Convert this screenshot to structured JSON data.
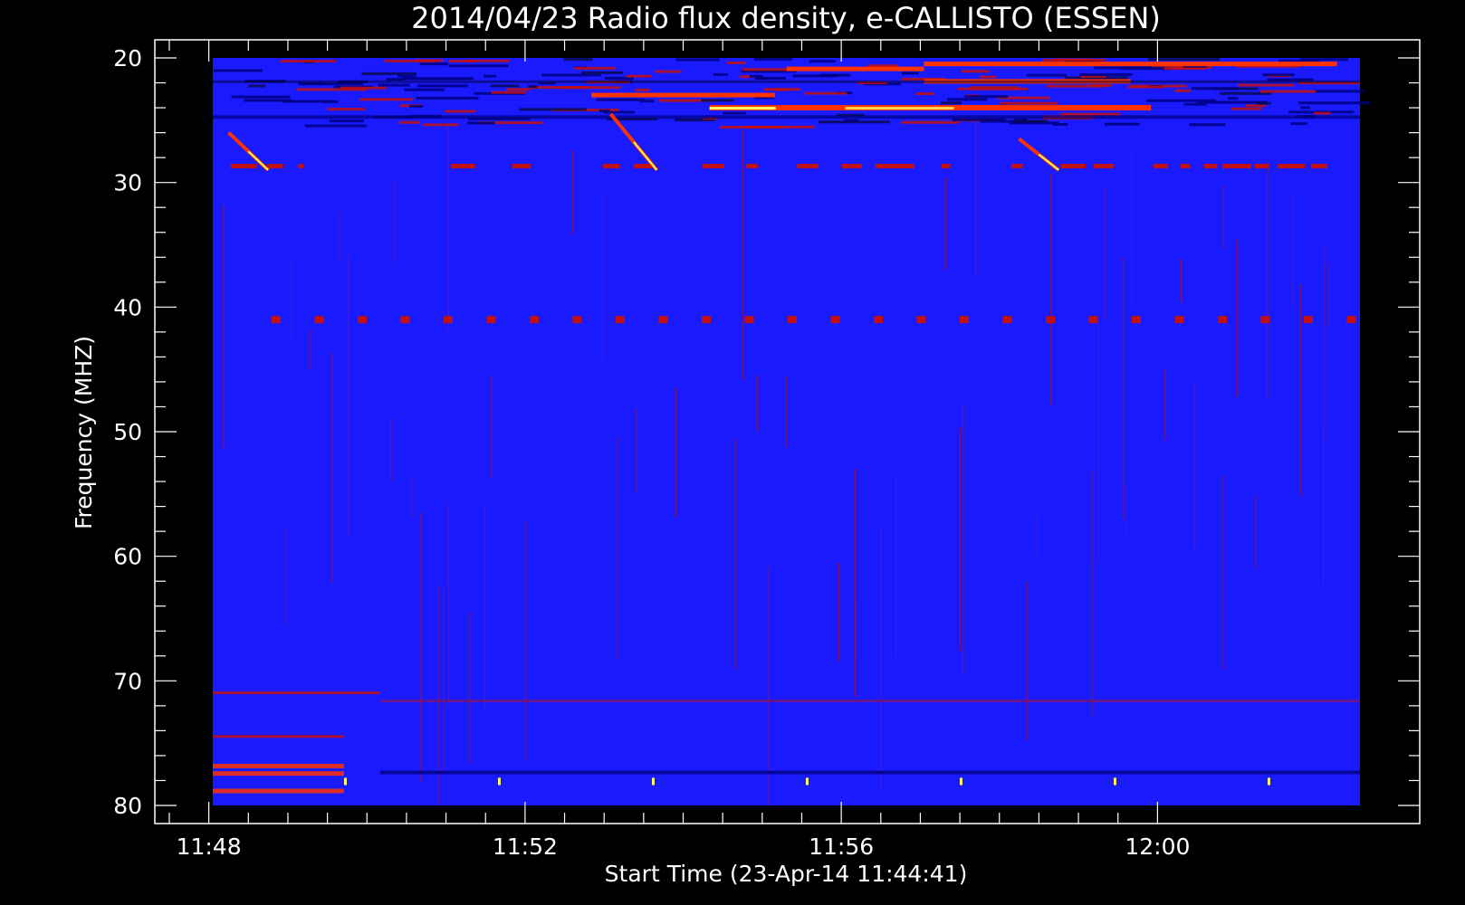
{
  "chart_data": {
    "type": "heatmap",
    "title": "2014/04/23  Radio flux density, e-CALLISTO (ESSEN)",
    "xlabel": "Start Time (23-Apr-14 11:44:41)",
    "ylabel": "Frequency (MHZ)",
    "x_start": "11:44:41",
    "x_end": "12:00:00",
    "x_axis_range_minutes": [
      -0.683,
      15.317
    ],
    "y_axis_range_mhz": [
      20,
      80
    ],
    "y_inverted": true,
    "x_ticks": [
      "11:48",
      "11:52",
      "11:56",
      "12:00"
    ],
    "y_ticks": [
      20,
      30,
      40,
      50,
      60,
      70,
      80
    ],
    "colors": {
      "background": "#1a1aff",
      "low": "#000080",
      "medium": "#c01010",
      "high": "#ff3300",
      "peak": "#ffff60"
    },
    "features": {
      "bursts": [
        {
          "t_start": "11:48:15",
          "t_end": "11:48:45",
          "f_start": 26,
          "f_end": 29
        },
        {
          "t_start": "11:53:05",
          "t_end": "11:53:40",
          "f_start": 24.5,
          "f_end": 29
        },
        {
          "t_start": "11:58:15",
          "t_end": "11:58:45",
          "f_start": 26.5,
          "f_end": 29
        }
      ],
      "bright_band": {
        "t_start": "11:54:20",
        "t_end": "11:59:55",
        "freq": 24
      },
      "periodic_dots_freq": 41,
      "low_band_activity_end": "11:50:10"
    }
  }
}
